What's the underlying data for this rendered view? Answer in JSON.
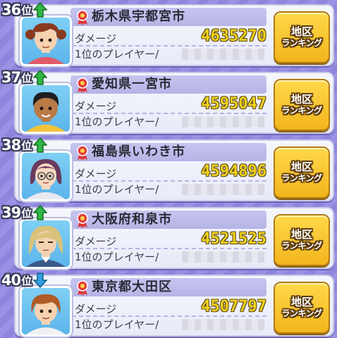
{
  "ranking": {
    "entries": [
      {
        "rank_number": "36",
        "rank_suffix": "位",
        "trend": "up",
        "location": "栃木県宇都宮市",
        "damage_label": "ダメージ",
        "damage_value": "4635270",
        "player_label": "1位のプレイヤー/",
        "player_name": "",
        "button_line1": "地区",
        "button_line2": "ランキング",
        "avatar": {
          "skin": "#f7d2b0",
          "hair": "#8a3a1e",
          "shirt": "#e05a6a"
        }
      },
      {
        "rank_number": "37",
        "rank_suffix": "位",
        "trend": "up",
        "location": "愛知県一宮市",
        "damage_label": "ダメージ",
        "damage_value": "4595047",
        "player_label": "1位のプレイヤー/",
        "player_name": "",
        "button_line1": "地区",
        "button_line2": "ランキング",
        "avatar": {
          "skin": "#b97a45",
          "hair": "#1e1e22",
          "shirt": "#f2c23a"
        }
      },
      {
        "rank_number": "38",
        "rank_suffix": "位",
        "trend": "up",
        "location": "福島県いわき市",
        "damage_label": "ダメージ",
        "damage_value": "4594896",
        "player_label": "1位のプレイヤー/",
        "player_name": "",
        "button_line1": "地区",
        "button_line2": "ランキング",
        "avatar": {
          "skin": "#f7d8c0",
          "hair": "#6a3a5e",
          "shirt": "#e8e8f0"
        }
      },
      {
        "rank_number": "39",
        "rank_suffix": "位",
        "trend": "up",
        "location": "大阪府和泉市",
        "damage_label": "ダメージ",
        "damage_value": "4521525",
        "player_label": "1位のプレイヤー/",
        "player_name": "",
        "button_line1": "地区",
        "button_line2": "ランキング",
        "avatar": {
          "skin": "#f3d2b2",
          "hair": "#d9c27a",
          "shirt": "#3a5a8a"
        }
      },
      {
        "rank_number": "40",
        "rank_suffix": "位",
        "trend": "down",
        "location": "東京都大田区",
        "damage_label": "ダメージ",
        "damage_value": "4507797",
        "player_label": "1位のプレイヤー/",
        "player_name": "",
        "button_line1": "地区",
        "button_line2": "ランキング",
        "avatar": {
          "skin": "#f7d2b0",
          "hair": "#b05a26",
          "shirt": "#f0f0f4"
        }
      }
    ]
  },
  "colors": {
    "background": "#8e86dc",
    "card": "#eef0fb",
    "title_band": "#bdbaea",
    "damage_value": "#f2d21d",
    "button": "#f6c62e",
    "trend_up": "#2fb845",
    "trend_down": "#2f9fe0",
    "medal": "#e23b3b"
  },
  "icons": {
    "trend_up": "green-up-arrow-icon",
    "trend_down": "blue-down-arrow-icon",
    "medal": "medal-ribbon-icon"
  }
}
